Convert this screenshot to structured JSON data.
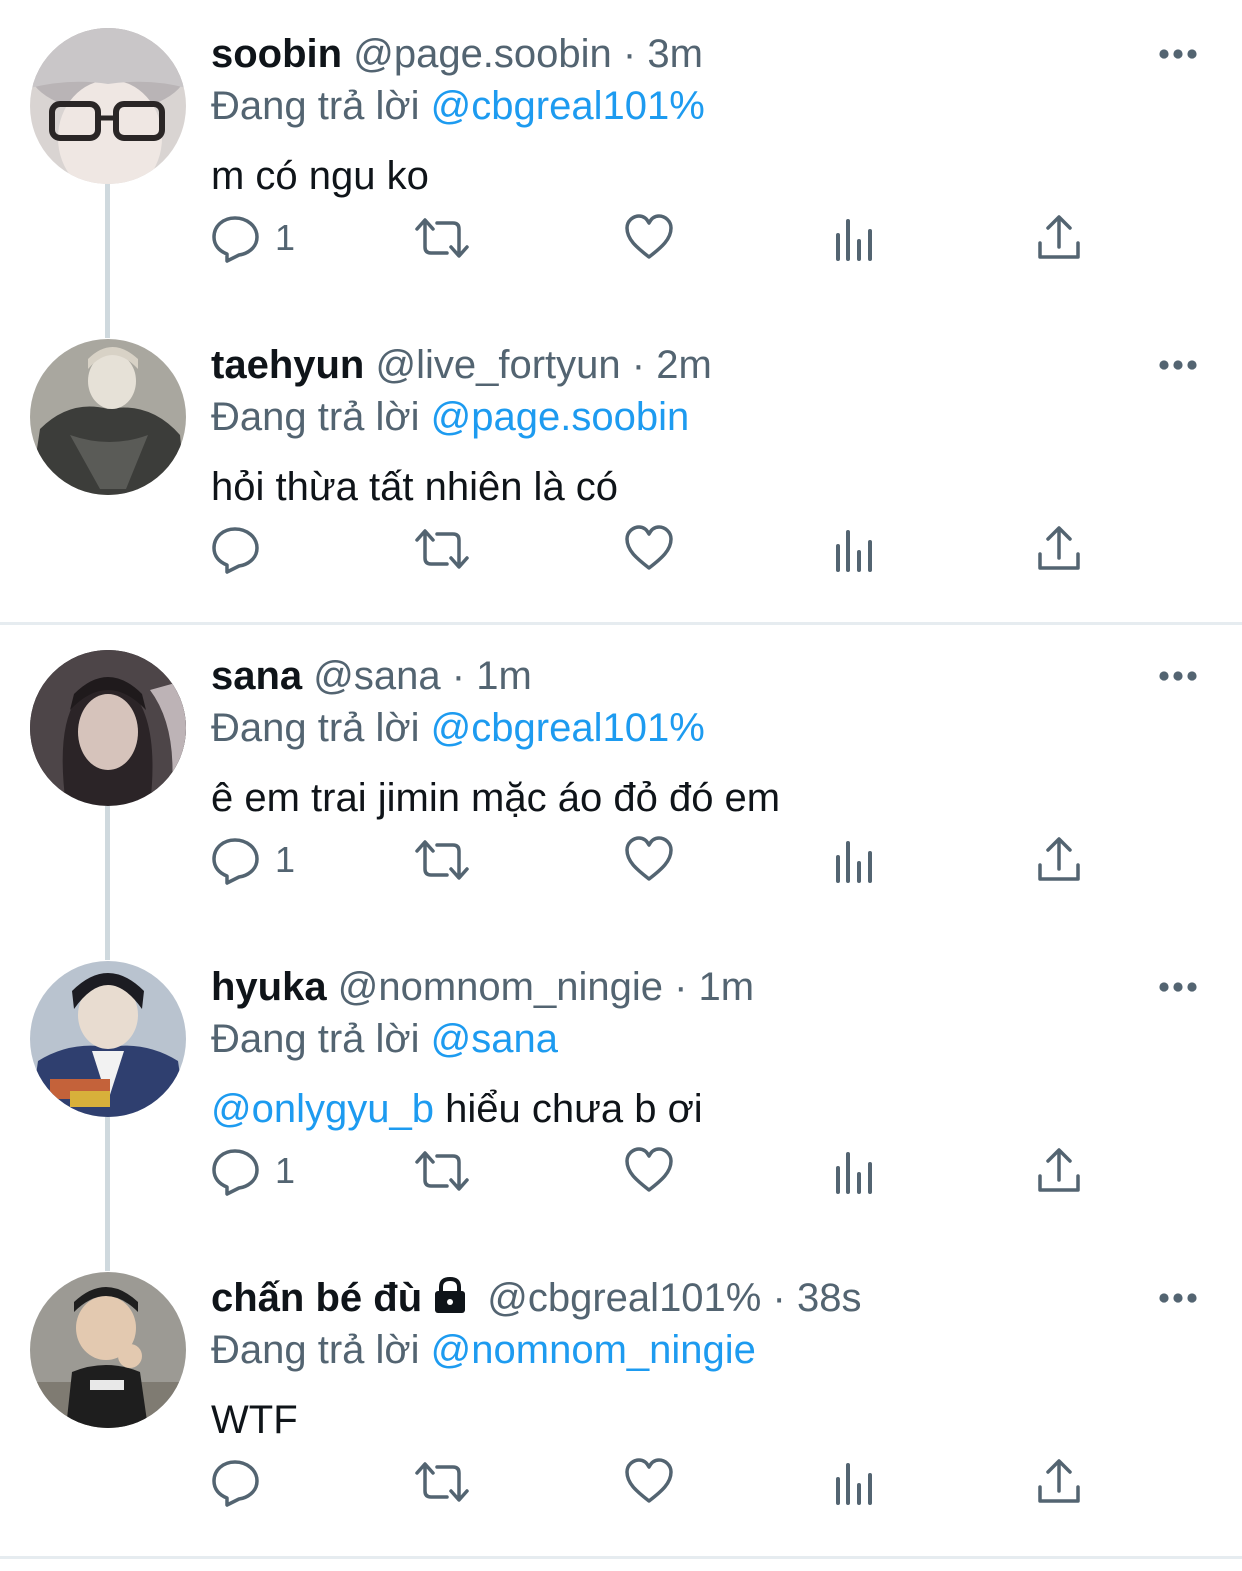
{
  "tweets": [
    {
      "name": "soobin",
      "handle": "@page.soobin",
      "time": "3m",
      "reply_prefix": "Đang trả lời",
      "reply_to": "@cbgreal101%",
      "text_mention": "",
      "text": "m có ngu ko",
      "reply_count": "1",
      "locked": false,
      "avatar_colors": [
        "#d9d4d2",
        "#6f6660",
        "#efe7e3"
      ]
    },
    {
      "name": "taehyun",
      "handle": "@live_fortyun",
      "time": "2m",
      "reply_prefix": "Đang trả lời",
      "reply_to": "@page.soobin",
      "text_mention": "",
      "text": "hỏi thừa tất nhiên là có",
      "reply_count": "",
      "locked": false,
      "avatar_colors": [
        "#8e8e86",
        "#3c3d3a",
        "#d8d2c6"
      ]
    },
    {
      "name": "sana",
      "handle": "@sana",
      "time": "1m",
      "reply_prefix": "Đang trả lời",
      "reply_to": "@cbgreal101%",
      "text_mention": "",
      "text": "ê em trai jimin mặc áo đỏ đó em",
      "reply_count": "1",
      "locked": false,
      "avatar_colors": [
        "#4d4548",
        "#1f1a1c",
        "#d6c3bb"
      ]
    },
    {
      "name": "hyuka",
      "handle": "@nomnom_ningie",
      "time": "1m",
      "reply_prefix": "Đang trả lời",
      "reply_to": "@sana",
      "text_mention": "@onlygyu_b",
      "text": " hiểu chưa b ơi",
      "reply_count": "1",
      "locked": false,
      "avatar_colors": [
        "#b9c3cf",
        "#2f3f6f",
        "#e8dcd0"
      ]
    },
    {
      "name": "chấn bé đù",
      "handle": "@cbgreal101%",
      "time": "38s",
      "reply_prefix": "Đang trả lời",
      "reply_to": "@nomnom_ningie",
      "text_mention": "",
      "text": "WTF",
      "reply_count": "",
      "locked": true,
      "avatar_colors": [
        "#9c9a94",
        "#1e1e1e",
        "#e3c9b0"
      ]
    }
  ],
  "icons": {
    "reply": "reply-icon",
    "retweet": "retweet-icon",
    "like": "heart-icon",
    "views": "views-icon",
    "share": "share-icon",
    "more": "more-icon",
    "lock": "lock-icon"
  },
  "colors": {
    "mention": "#1d9bf0",
    "secondary_text": "#536471",
    "primary_text": "#0f1419",
    "thread_line": "#cfd9de"
  }
}
